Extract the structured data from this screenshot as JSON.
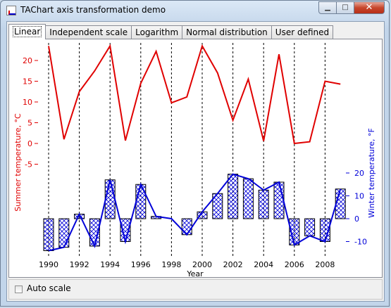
{
  "window": {
    "title": "TAChart axis transformation demo"
  },
  "window_buttons": {
    "minimize": "▁",
    "maximize": "□",
    "close": "✕"
  },
  "tabs": [
    {
      "label": "Linear",
      "active": true
    },
    {
      "label": "Independent scale",
      "active": false
    },
    {
      "label": "Logarithm",
      "active": false
    },
    {
      "label": "Normal distribution",
      "active": false
    },
    {
      "label": "User defined",
      "active": false
    }
  ],
  "options": {
    "auto_scale_label": "Auto scale",
    "auto_scale_checked": false
  },
  "chart_data": {
    "type": "line",
    "xlabel": "Year",
    "ylabel_left": "Summer temperature, °C",
    "ylabel_right": "Winter temperature, °F",
    "x_ticks": [
      1990,
      1992,
      1994,
      1996,
      1998,
      2000,
      2002,
      2004,
      2006,
      2008
    ],
    "left_ticks": [
      20,
      15,
      10,
      5,
      0,
      -5
    ],
    "right_ticks": [
      20,
      10,
      0,
      -10
    ],
    "colors": {
      "summer": "#e00000",
      "winter": "#0000d8",
      "bars": "#0000d8"
    },
    "series": [
      {
        "name": "Summer temperature, °C",
        "axis": "left",
        "kind": "line",
        "x": [
          1990,
          1991,
          1992,
          1993,
          1994,
          1995,
          1996,
          1997,
          1998,
          1999,
          2000,
          2001,
          2002,
          2003,
          2004,
          2005,
          2006,
          2007,
          2008,
          2009
        ],
        "values": [
          23.5,
          1,
          12.5,
          17.5,
          23.5,
          0.7,
          14.5,
          22.2,
          9.8,
          11.2,
          23.5,
          17,
          5.6,
          15.5,
          0.6,
          21.5,
          0,
          0.4,
          15,
          14.3
        ]
      },
      {
        "name": "Winter temperature, °F",
        "axis": "right",
        "kind": "line+bar",
        "x": [
          1990,
          1991,
          1992,
          1993,
          1994,
          1995,
          1996,
          1997,
          1998,
          1999,
          2000,
          2001,
          2002,
          2003,
          2004,
          2005,
          2006,
          2007,
          2008,
          2009
        ],
        "values": [
          -14,
          -12.5,
          2,
          -12,
          17,
          -10,
          15,
          1,
          0,
          -7,
          3,
          11,
          19.5,
          17.5,
          12.5,
          16,
          -11.5,
          -7.5,
          -10,
          13
        ]
      }
    ],
    "xlim": [
      1989.5,
      2009.5
    ],
    "left_ylim": [
      -9.5,
      25
    ],
    "right_ylim": [
      -14,
      20
    ],
    "grid_x": "dashed-vertical"
  }
}
